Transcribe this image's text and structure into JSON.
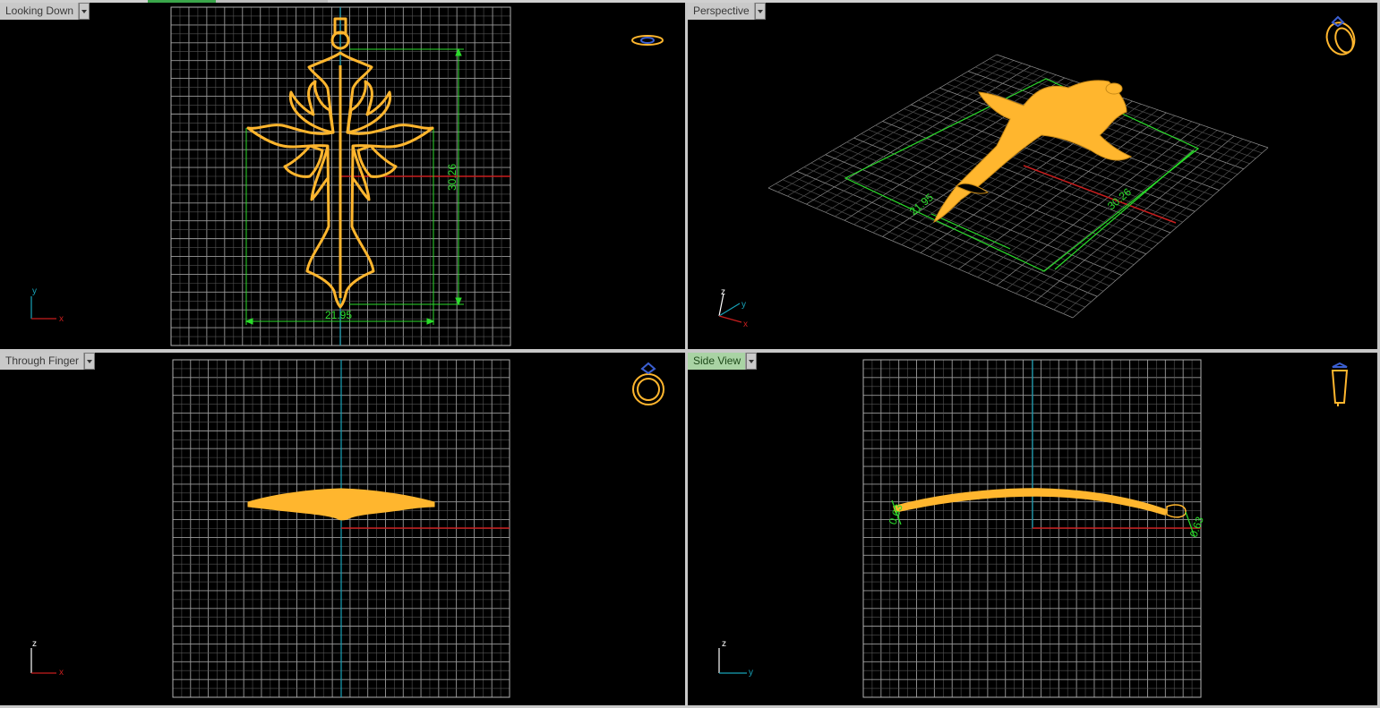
{
  "viewports": {
    "top": {
      "label": "Looking Down",
      "dim_width": "21.95",
      "dim_height": "30.26"
    },
    "perspective": {
      "label": "Perspective",
      "dim_a": "21.95",
      "dim_b": "30.26"
    },
    "front": {
      "label": "Through Finger"
    },
    "side": {
      "label": "Side View",
      "dim_left": "0.63",
      "dim_right": "0.63"
    }
  },
  "axes": {
    "top": {
      "x": "x",
      "y": "y"
    },
    "perspective": {
      "x": "x",
      "y": "y",
      "z": "z"
    },
    "front": {
      "x": "x",
      "z": "z"
    },
    "side": {
      "y": "y",
      "z": "z"
    }
  },
  "icons": {
    "top": "ring-top-view-icon",
    "perspective": "ring-perspective-view-icon",
    "front": "ring-front-view-icon",
    "side": "ring-side-view-icon"
  },
  "colors": {
    "background": "#000000",
    "grid": "#8a8a8a",
    "object": "#ffb62e",
    "dimension": "#2bdc2b",
    "x_axis": "#c81e1e",
    "y_axis": "#17a2b8",
    "active_label": "#a9d3a4"
  }
}
